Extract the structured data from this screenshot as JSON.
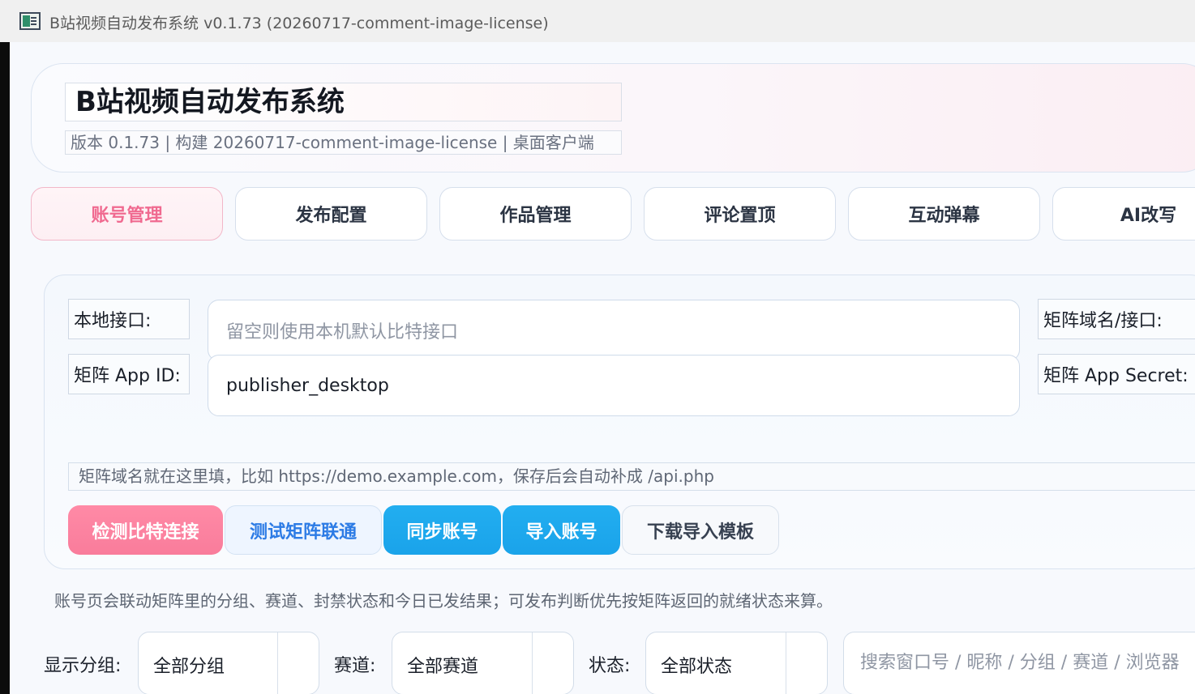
{
  "window": {
    "title": "B站视频自动发布系统 v0.1.73 (20260717-comment-image-license)"
  },
  "header": {
    "title": "B站视频自动发布系统",
    "meta": "版本 0.1.73  |  构建 20260717-comment-image-license  |  桌面客户端"
  },
  "tabs": [
    {
      "label": "账号管理",
      "active": true
    },
    {
      "label": "发布配置",
      "active": false
    },
    {
      "label": "作品管理",
      "active": false
    },
    {
      "label": "评论置顶",
      "active": false
    },
    {
      "label": "互动弹幕",
      "active": false
    },
    {
      "label": "AI改写",
      "active": false
    }
  ],
  "form": {
    "local_api_label": "本地接口:",
    "local_api_placeholder": "留空则使用本机默认比特接口",
    "matrix_domain_label": "矩阵域名/接口:",
    "app_id_label": "矩阵 App ID:",
    "app_id_value": "publisher_desktop",
    "app_secret_label": "矩阵 App Secret:",
    "hint": "矩阵域名就在这里填，比如 https://demo.example.com，保存后会自动补成 /api.php"
  },
  "buttons": {
    "check_bit": "检测比特连接",
    "test_matrix": "测试矩阵联通",
    "sync_accounts": "同步账号",
    "import_accounts": "导入账号",
    "download_template": "下载导入模板"
  },
  "note": "账号页会联动矩阵里的分组、赛道、封禁状态和今日已发结果；可发布判断优先按矩阵返回的就绪状态来算。",
  "filters": {
    "group_label": "显示分组:",
    "group_value": "全部分组",
    "track_label": "赛道:",
    "track_value": "全部赛道",
    "status_label": "状态:",
    "status_value": "全部状态",
    "search_placeholder": "搜索窗口号 / 昵称 / 分组 / 赛道 / 浏览器"
  },
  "colors": {
    "accent_pink": "#f97c9b",
    "accent_blue": "#1aa3ea",
    "link_blue": "#2c7be5"
  }
}
